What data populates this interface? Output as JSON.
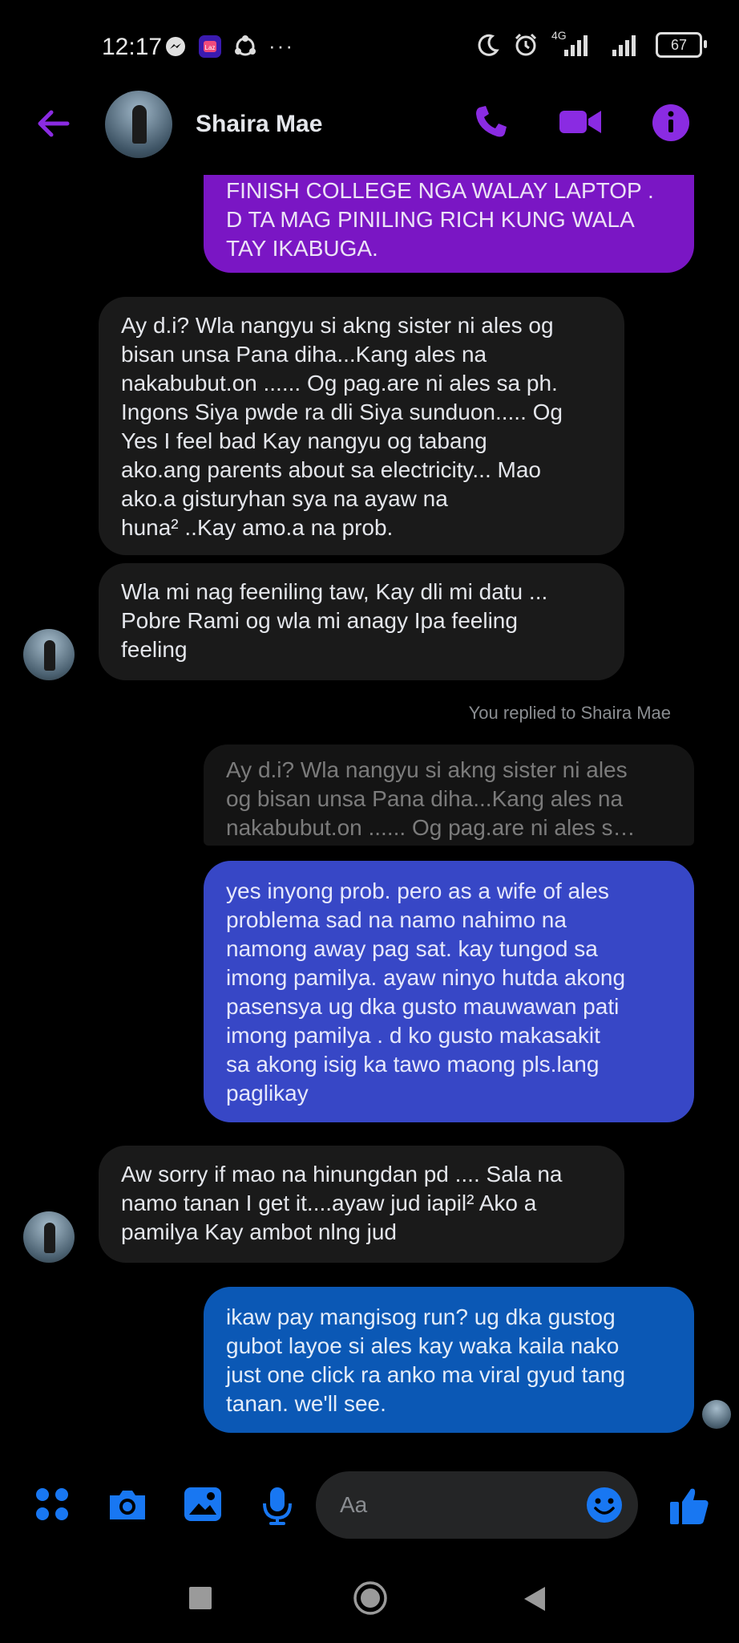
{
  "status_bar": {
    "time": "12:17",
    "network": "4G",
    "battery": "67",
    "overflow": "···"
  },
  "header": {
    "contact_name": "Shaira Mae",
    "accent_color": "#8a2be2"
  },
  "messages": [
    {
      "direction": "outgoing",
      "lines": [
        "FINISH COLLEGE NGA WALAY LAPTOP .",
        "D TA MAG PINILING RICH KUNG WALA",
        "TAY IKABUGA."
      ]
    },
    {
      "direction": "incoming",
      "lines": [
        "Ay d.i? Wla nangyu si akng sister ni ales og",
        "bisan unsa Pana diha...Kang ales na",
        "nakabubut.on ...... Og pag.are ni ales sa ph.",
        "Ingons Siya pwde ra dli Siya sunduon..... Og",
        "Yes I feel bad Kay nangyu og tabang",
        "ako.ang parents about sa electricity... Mao",
        "ako.a gisturyhan sya na ayaw na",
        "huna² ..Kay amo.a na prob."
      ]
    },
    {
      "direction": "incoming",
      "lines": [
        "Wla mi nag feeniling taw, Kay dli mi datu ...",
        "Pobre Rami og wla mi anagy Ipa feeling",
        "feeling"
      ]
    },
    {
      "type": "reply_label",
      "text": "You replied to Shaira Mae"
    },
    {
      "type": "quoted",
      "lines": [
        "Ay d.i? Wla nangyu si akng sister ni ales",
        "og bisan unsa Pana diha...Kang ales na",
        "nakabubut.on ...... Og pag.are ni ales s…"
      ]
    },
    {
      "direction": "outgoing",
      "lines": [
        "yes inyong prob. pero as a wife of ales",
        "problema sad na namo nahimo na",
        "namong away pag sat. kay tungod sa",
        "imong pamilya. ayaw ninyo hutda akong",
        "pasensya ug dka gusto mauwawan pati",
        "imong pamilya . d ko gusto makasakit",
        "sa akong isig ka tawo maong pls.lang",
        "paglikay"
      ]
    },
    {
      "direction": "incoming",
      "lines": [
        "Aw sorry if mao na hinungdan pd .... Sala na",
        "namo tanan I get it....ayaw jud iapil² Ako a",
        "pamilya Kay ambot nlng jud"
      ]
    },
    {
      "direction": "outgoing",
      "lines": [
        "ikaw pay mangisog run? ug dka gustog",
        "gubot layoe si ales kay waka kaila nako",
        "just one click ra anko ma viral gyud tang",
        "tanan. we'll see."
      ]
    }
  ],
  "composer": {
    "placeholder": "Aa",
    "accent_color": "#1877f2"
  },
  "icons": [
    "messenger-icon",
    "lazada-icon",
    "app-icon",
    "moon-icon",
    "alarm-icon",
    "signal-icon",
    "back-arrow-icon",
    "phone-icon",
    "video-icon",
    "info-icon",
    "apps-icon",
    "camera-icon",
    "gallery-icon",
    "mic-icon",
    "emoji-icon",
    "thumbs-up-icon",
    "recents-icon",
    "home-icon",
    "nav-back-icon"
  ]
}
